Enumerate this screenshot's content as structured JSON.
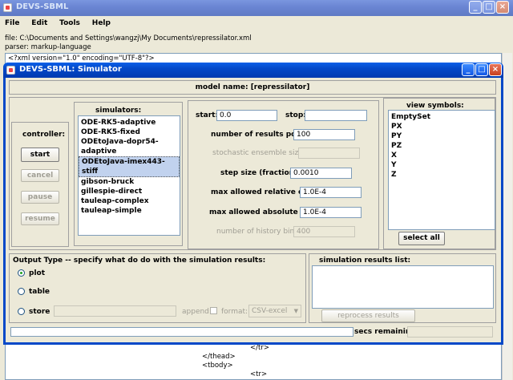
{
  "main_window": {
    "title": "DEVS-SBML",
    "menu": [
      "File",
      "Edit",
      "Tools",
      "Help"
    ],
    "file_path": "file: C:\\Documents and Settings\\wangzj\\My Documents\\repressilator.xml",
    "parser": "parser: markup-language",
    "xml_first_line": "<?xml version=\"1.0\" encoding=\"UTF-8\"?>",
    "xml_bottom_lines": [
      "</tr>",
      "</thead>",
      "<tbody>",
      "<tr>"
    ]
  },
  "sim_window": {
    "title": "DEVS-SBML: Simulator",
    "model_name": "model name: [repressilator]",
    "controller": {
      "label": "controller:",
      "start": "start",
      "cancel": "cancel",
      "pause": "pause",
      "resume": "resume"
    },
    "simulators": {
      "label": "simulators:",
      "items": [
        "ODE-RK5-adaptive",
        "ODE-RK5-fixed",
        "ODEtoJava-dopr54-adaptive",
        "ODEtoJava-imex443-stiff",
        "gibson-bruck",
        "gillespie-direct",
        "tauleap-complex",
        "tauleap-simple"
      ],
      "selected_index": 3
    },
    "params": {
      "start_label": "start:",
      "start_value": "0.0",
      "stop_label": "stop:",
      "stop_value": "",
      "num_points_label": "number of results points:",
      "num_points_value": "100",
      "ensemble_label": "stochastic ensemble size:",
      "ensemble_value": "",
      "step_label": "step size (fractional):",
      "step_value": "0.0010",
      "rel_err_label": "max allowed relative error:",
      "rel_err_value": "1.0E-4",
      "abs_err_label": "max allowed absolute error:",
      "abs_err_value": "1.0E-4",
      "history_label": "number of history bins:",
      "history_value": "400"
    },
    "view_symbols": {
      "label": "view symbols:",
      "items": [
        "EmptySet",
        "PX",
        "PY",
        "PZ",
        "X",
        "Y",
        "Z"
      ],
      "select_all": "select all"
    },
    "output": {
      "label": "Output Type -- specify what do do with the simulation results:",
      "plot": "plot",
      "table": "table",
      "store": "store",
      "append": "append:",
      "format": "format:",
      "format_value": "CSV-excel"
    },
    "results": {
      "label": "simulation results list:",
      "reprocess": "reprocess results"
    },
    "secs_remaining": "secs remaining:"
  }
}
